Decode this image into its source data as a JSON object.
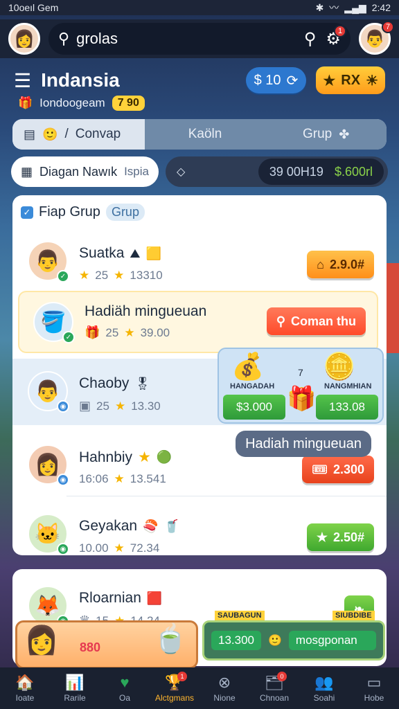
{
  "status": {
    "time_left": "10oeıl Gem",
    "time_right": "2:42"
  },
  "top": {
    "search_text": "grolas",
    "notifications_badge": "1",
    "profile_badge": "7"
  },
  "header": {
    "title": "Indansia",
    "subtitle": "Iondoogeam",
    "level": "7 90",
    "coins": "$ 10",
    "gems": "RX"
  },
  "tabs": [
    "Convap",
    "Kaöln",
    "Grup"
  ],
  "filters": {
    "chip1": "Diagan Nawık",
    "chip1_sub": "Ispia",
    "seg_left": "39 00H19",
    "seg_right": "$.600rl"
  },
  "panel": {
    "title": "Fiap Grup",
    "chip": "Grup"
  },
  "rows": [
    {
      "name": "Suatka",
      "stat1": "25",
      "stat2": "13310",
      "cta": "2.9.0#",
      "icon": "👨"
    },
    {
      "name": "Hadiäh mingueuan",
      "stat1": "25",
      "stat2": "39.00",
      "cta": "Coman thu",
      "icon": "🪣"
    },
    {
      "name": "Chaoby",
      "stat1": "25",
      "stat2": "13.30",
      "cta": "",
      "icon": "👨"
    },
    {
      "name": "Hahnbiy",
      "stat1": "16:06",
      "stat2": "13.541",
      "cta": "2.300",
      "icon": "👩"
    },
    {
      "name": "Geyakan",
      "stat1": "10.00",
      "stat2": "72.34",
      "cta": "2.50#",
      "icon": "🐱"
    },
    {
      "name": "Rloarnian",
      "stat1": "15",
      "stat2": "14.24",
      "cta": "",
      "icon": "🦊"
    }
  ],
  "reward": {
    "label_left": "HANGADAH",
    "label_right": "NANGMHIAN",
    "btn_left": "$3.000",
    "btn_right": "133.08",
    "num": "7"
  },
  "tooltip": "Hadiah mingueuan",
  "promo": {
    "left_value": "880",
    "right_small": "13.300",
    "right_big": "mosgponan",
    "right_label_left": "SAUBAGUN",
    "right_label_right": "SIUBDIBE"
  },
  "nav": [
    {
      "label": "Ioate",
      "icon": "🏠"
    },
    {
      "label": "Rarile",
      "icon": "📊"
    },
    {
      "label": "Oa",
      "icon": "♥"
    },
    {
      "label": "Alctgmans",
      "icon": "🏆",
      "badge": "1"
    },
    {
      "label": "Nione",
      "icon": "⊗"
    },
    {
      "label": "Chnoan",
      "icon": "🗂",
      "badge": "0"
    },
    {
      "label": "Soahi",
      "icon": "👥"
    },
    {
      "label": "Hobe",
      "icon": "▭"
    }
  ]
}
